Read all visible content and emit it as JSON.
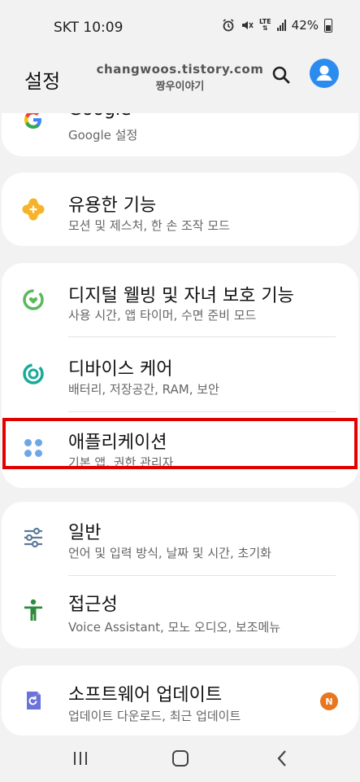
{
  "status_bar": {
    "carrier_time": "SKT 10:09",
    "battery_percent": "42%",
    "network": "LTE"
  },
  "header": {
    "title": "설정",
    "watermark_line1": "changwoos.tistory.com",
    "watermark_line2": "짱우이야기"
  },
  "cards": [
    {
      "items": [
        {
          "title": "Google",
          "subtitle": "Google 설정",
          "icon": "google-icon"
        }
      ]
    },
    {
      "items": [
        {
          "title": "유용한 기능",
          "subtitle": "모션 및 제스처, 한 손 조작 모드",
          "icon": "puzzle-plus-icon"
        }
      ]
    },
    {
      "items": [
        {
          "title": "디지털 웰빙 및 자녀 보호 기능",
          "subtitle": "사용 시간, 앱 타이머, 수면 준비 모드",
          "icon": "wellbeing-icon"
        },
        {
          "title": "디바이스 케어",
          "subtitle": "배터리, 저장공간, RAM, 보안",
          "icon": "device-care-icon"
        },
        {
          "title": "애플리케이션",
          "subtitle": "기본 앱, 권한 관리자",
          "icon": "apps-grid-icon"
        }
      ]
    },
    {
      "items": [
        {
          "title": "일반",
          "subtitle": "언어 및 입력 방식, 날짜 및 시간, 초기화",
          "icon": "sliders-icon"
        },
        {
          "title": "접근성",
          "subtitle": "Voice Assistant, 모노 오디오, 보조메뉴",
          "icon": "accessibility-icon"
        }
      ]
    },
    {
      "items": [
        {
          "title": "소프트웨어 업데이트",
          "subtitle": "업데이트 다운로드, 최근 업데이트",
          "icon": "software-update-icon",
          "badge": "N"
        }
      ]
    }
  ],
  "colors": {
    "highlight": "#e00000",
    "accent_blue": "#2b8cf0",
    "badge_orange": "#e8761e"
  }
}
